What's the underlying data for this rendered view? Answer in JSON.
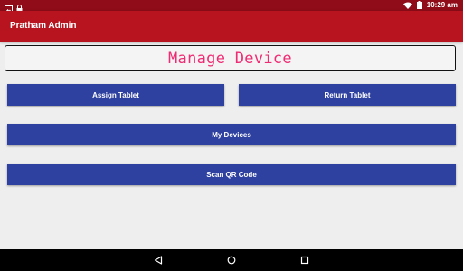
{
  "status_bar": {
    "time": "10:29 am",
    "icons": [
      "image-icon",
      "lock-icon",
      "wifi-icon",
      "battery-icon"
    ]
  },
  "app_bar": {
    "title": "Pratham Admin"
  },
  "header": {
    "title": "Manage Device"
  },
  "buttons": {
    "assign_tablet": "Assign Tablet",
    "return_tablet": "Return Tablet",
    "my_devices": "My Devices",
    "scan_qr": "Scan QR Code"
  },
  "nav_bar": {
    "icons": [
      "back-icon",
      "home-icon",
      "recents-icon"
    ]
  },
  "colors": {
    "status_bar": "#8f0c18",
    "app_bar": "#b71420",
    "button": "#2e40a0",
    "header_text": "#ef2b73",
    "background": "#eeeeee"
  }
}
